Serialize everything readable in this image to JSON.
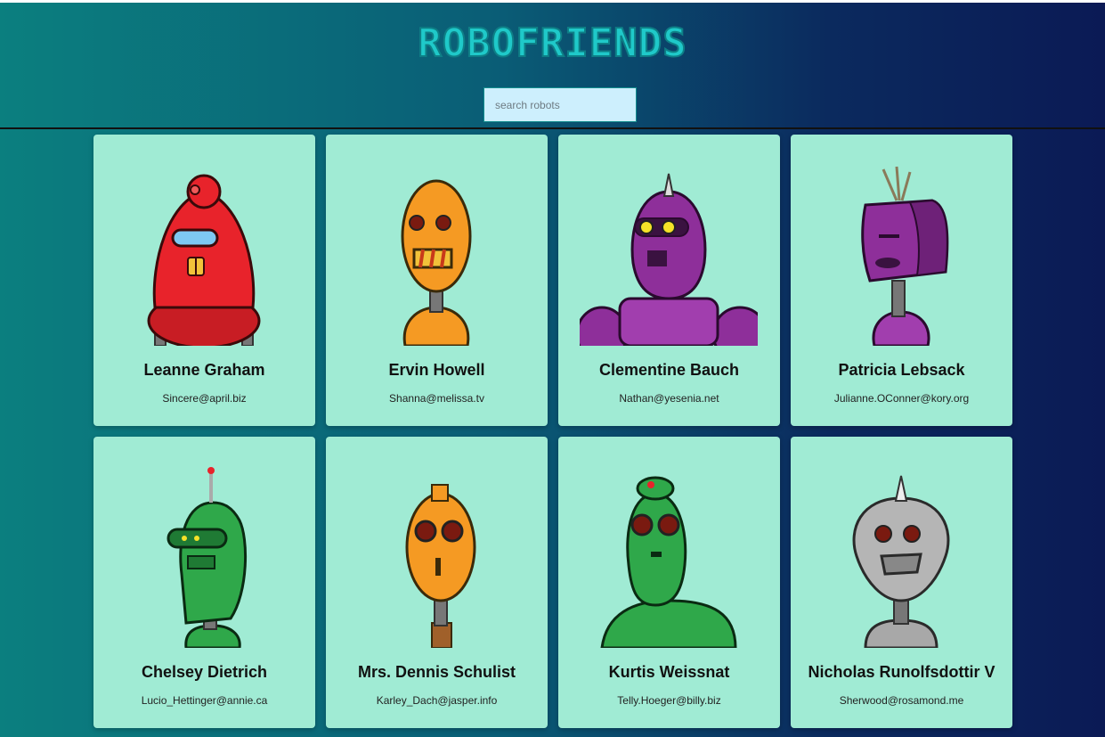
{
  "app": {
    "title": "ROBOFRIENDS"
  },
  "search": {
    "placeholder": "search robots",
    "value": ""
  },
  "colors": {
    "card_background": "#a0ebd4",
    "title_color": "#1fc9c9",
    "search_background": "#cdeffd"
  },
  "robots": [
    {
      "name": "Leanne Graham",
      "email": "Sincere@april.biz",
      "robot_color": "#e8232b",
      "icon": "red-robot-avatar"
    },
    {
      "name": "Ervin Howell",
      "email": "Shanna@melissa.tv",
      "robot_color": "#f59a23",
      "icon": "orange-robot-avatar"
    },
    {
      "name": "Clementine Bauch",
      "email": "Nathan@yesenia.net",
      "robot_color": "#8e2f9a",
      "icon": "purple-robot-avatar"
    },
    {
      "name": "Patricia Lebsack",
      "email": "Julianne.OConner@kory.org",
      "robot_color": "#8e2f9a",
      "icon": "purple-robot-avatar"
    },
    {
      "name": "Chelsey Dietrich",
      "email": "Lucio_Hettinger@annie.ca",
      "robot_color": "#2fa84a",
      "icon": "green-robot-avatar"
    },
    {
      "name": "Mrs. Dennis Schulist",
      "email": "Karley_Dach@jasper.info",
      "robot_color": "#f59a23",
      "icon": "orange-robot-avatar"
    },
    {
      "name": "Kurtis Weissnat",
      "email": "Telly.Hoeger@billy.biz",
      "robot_color": "#2fa84a",
      "icon": "green-robot-avatar"
    },
    {
      "name": "Nicholas Runolfsdottir V",
      "email": "Sherwood@rosamond.me",
      "robot_color": "#a8a8a8",
      "icon": "gray-robot-avatar"
    }
  ]
}
